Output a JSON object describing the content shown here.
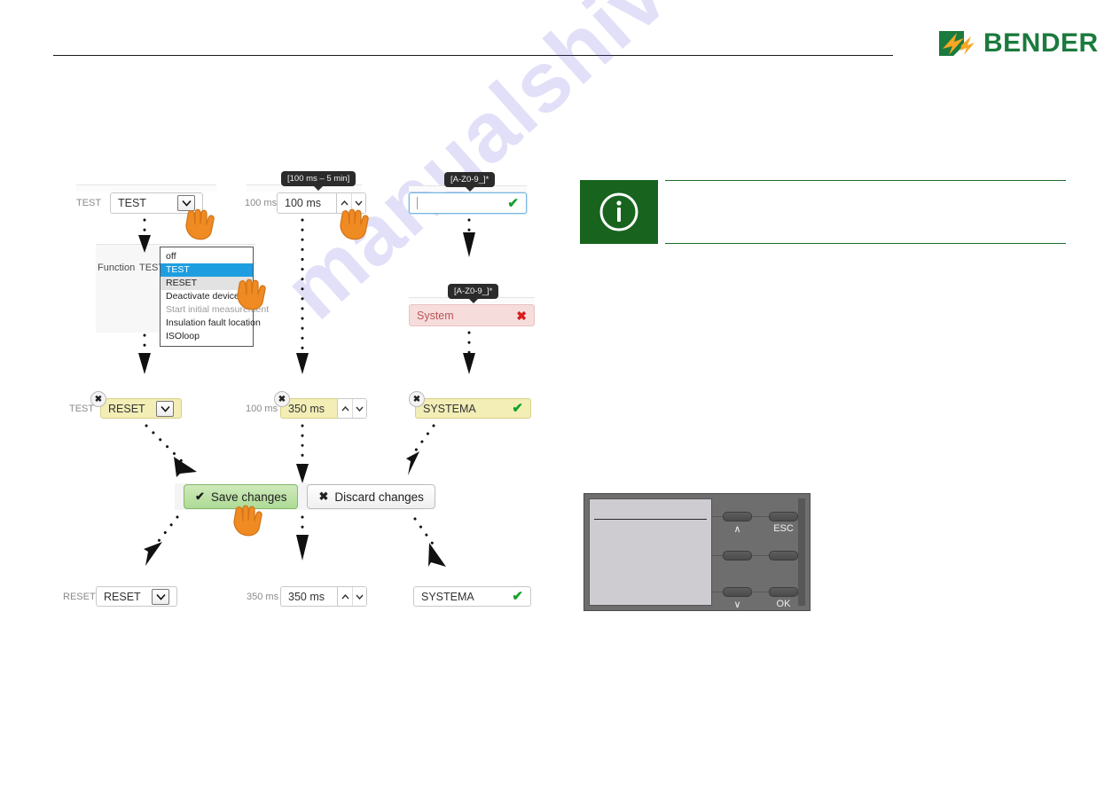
{
  "header": {
    "brand": "BENDER",
    "logo_icon": "bender-lightning-logo",
    "rule": true
  },
  "watermark": {
    "text": "manualshive.com"
  },
  "flow": {
    "columns": [
      {
        "id": "function-select",
        "steps": [
          {
            "stage": "initial",
            "label": "TEST",
            "value": "TEST",
            "control": "select",
            "state": "normal"
          },
          {
            "stage": "dropdown-open",
            "row_label": "Function",
            "row_value": "TEST",
            "options": [
              {
                "label": "off",
                "state": "normal"
              },
              {
                "label": "TEST",
                "state": "selected"
              },
              {
                "label": "RESET",
                "state": "hover"
              },
              {
                "label": "Deactivate device",
                "state": "normal"
              },
              {
                "label": "Start initial measurement",
                "state": "disabled"
              },
              {
                "label": "Insulation fault location",
                "state": "normal"
              },
              {
                "label": "ISOloop",
                "state": "normal"
              }
            ]
          },
          {
            "stage": "modified",
            "label": "TEST",
            "value": "RESET",
            "control": "select",
            "state": "modified",
            "reset_badge": "✖"
          },
          {
            "stage": "saved",
            "label": "RESET",
            "value": "RESET",
            "control": "select",
            "state": "normal"
          }
        ]
      },
      {
        "id": "delay-spinner",
        "steps": [
          {
            "stage": "initial",
            "tooltip": "[100 ms – 5 min]",
            "label": "100 ms",
            "value": "100 ms",
            "control": "spinner",
            "state": "normal"
          },
          {
            "stage": "modified",
            "label": "100 ms",
            "value": "350 ms",
            "control": "spinner",
            "state": "modified",
            "reset_badge": "✖"
          },
          {
            "stage": "saved",
            "label": "350 ms",
            "value": "350 ms",
            "control": "spinner",
            "state": "normal"
          }
        ]
      },
      {
        "id": "name-text",
        "steps": [
          {
            "stage": "empty-focused",
            "tooltip": "[A-Z0-9_]*",
            "value": "",
            "control": "text",
            "state": "focused",
            "validation": "valid"
          },
          {
            "stage": "invalid",
            "tooltip": "[A-Z0-9_]*",
            "value": "System",
            "control": "text",
            "state": "error",
            "validation": "invalid"
          },
          {
            "stage": "modified",
            "value": "SYSTEMA",
            "control": "text",
            "state": "modified",
            "validation": "valid",
            "reset_badge": "✖"
          },
          {
            "stage": "saved",
            "value": "SYSTEMA",
            "control": "text",
            "state": "normal",
            "validation": "valid"
          }
        ]
      }
    ],
    "actions": {
      "save_label": "Save changes",
      "save_icon": "✔",
      "discard_label": "Discard changes",
      "discard_icon": "✖"
    },
    "cursor_icon": "pointing-hand"
  },
  "note": {
    "icon": "info-icon",
    "icon_glyph": "i",
    "body": ""
  },
  "device": {
    "name": "control-panel",
    "keys": [
      {
        "position": "top-left",
        "label": "∧"
      },
      {
        "position": "top-right",
        "label": "ESC"
      },
      {
        "position": "mid-left",
        "label": ""
      },
      {
        "position": "mid-right",
        "label": ""
      },
      {
        "position": "bottom-left",
        "label": "∨"
      },
      {
        "position": "bottom-right",
        "label": "OK"
      }
    ]
  },
  "colors": {
    "brand_green": "#1b7a3d",
    "note_green": "#18641f",
    "accent_orange": "#f08a22",
    "modified_yellow": "#f2eeb6",
    "error_pink": "#f7dcdc",
    "valid_green": "#13a02b",
    "invalid_red": "#d81d1d",
    "select_blue": "#1e9ee0"
  }
}
